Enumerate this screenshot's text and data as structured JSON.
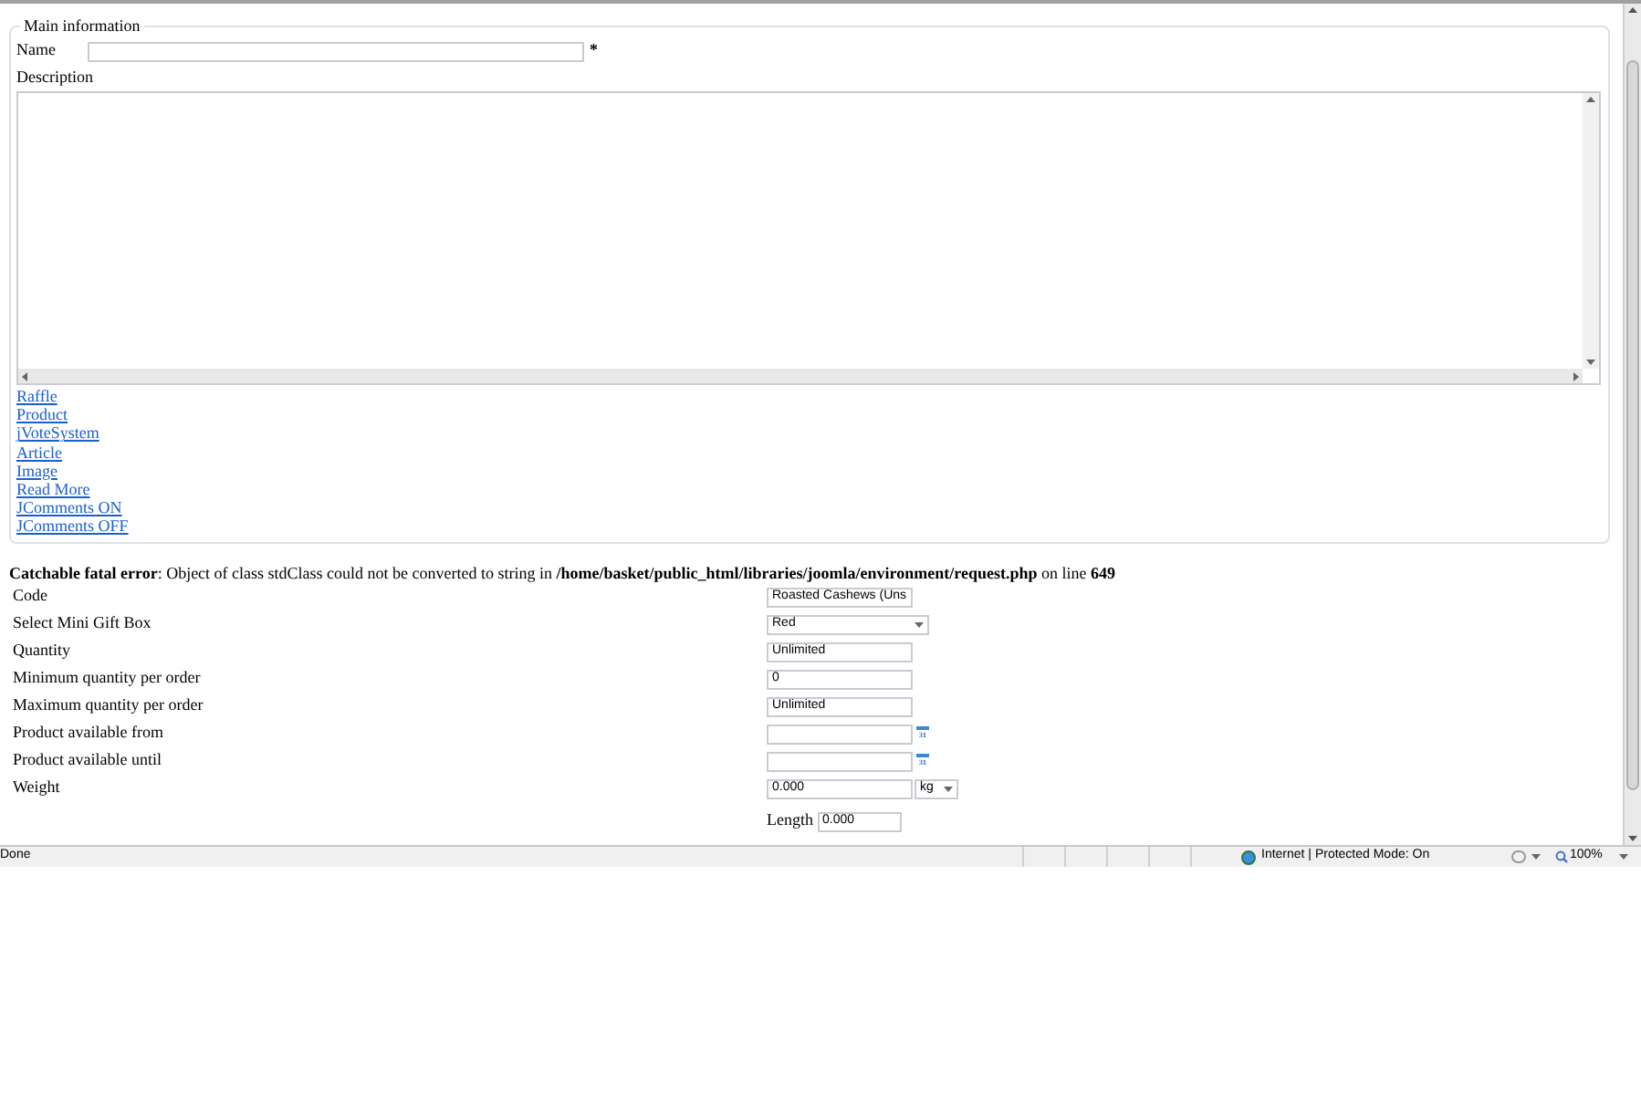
{
  "main_information": {
    "legend": "Main information",
    "name_label": "Name",
    "required_mark": "*",
    "description_label": "Description"
  },
  "links": [
    "Raffle",
    "Product",
    "jVoteSystem",
    "Article",
    "Image",
    "Read More",
    "JComments ON",
    "JComments OFF"
  ],
  "error_message": "**Catchable fatal error**: Object of class stdClass could not be converted to string in **/home/basket/public_html/libraries/joomla/environment/request.php** on line **649**",
  "form_rows": [
    {
      "kind": "text",
      "label": "Code",
      "value": "Roasted Cashews (Uns"
    },
    {
      "kind": "select",
      "label": "Select Mini Gift Box",
      "value": "Red"
    },
    {
      "kind": "text",
      "label": "Quantity",
      "value": "Unlimited"
    },
    {
      "kind": "text",
      "label": "Minimum quantity per order",
      "value": "0"
    },
    {
      "kind": "text",
      "label": "Maximum quantity per order",
      "value": "Unlimited"
    },
    {
      "kind": "date",
      "label": "Product available from",
      "calendar_day": "31"
    },
    {
      "kind": "date",
      "label": "Product available until",
      "calendar_day": "31"
    },
    {
      "kind": "unit",
      "label": "Weight",
      "value": "0.000",
      "unit": "kg"
    },
    {
      "kind": "dimension",
      "sub_label": "Length",
      "value": "0.000"
    }
  ],
  "status_bar": {
    "text": "Done",
    "zone": "Internet | Protected Mode: On",
    "zoom": "100%"
  }
}
